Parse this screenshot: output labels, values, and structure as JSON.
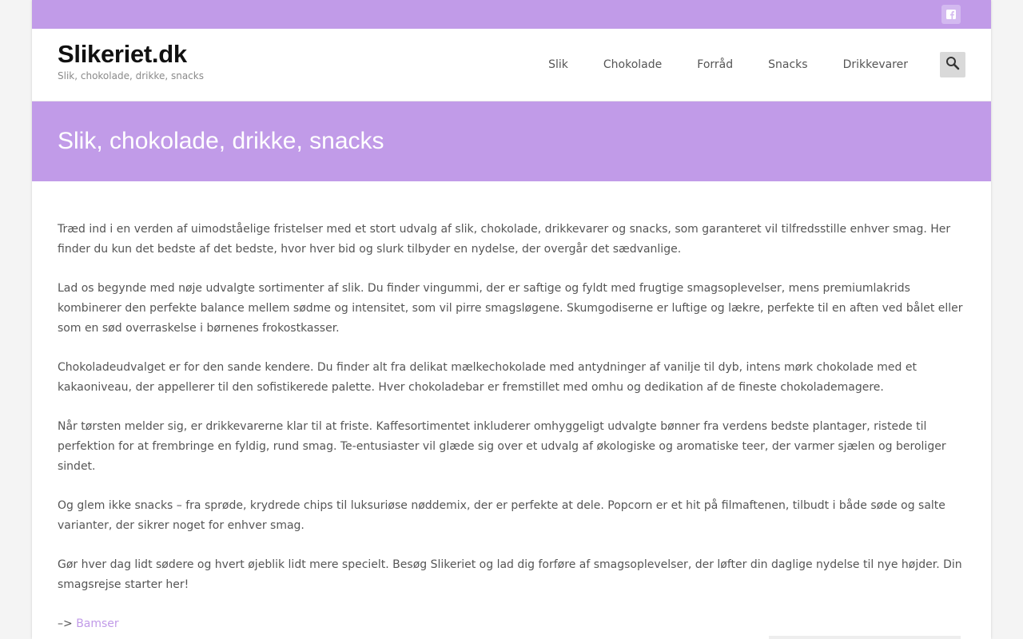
{
  "topbar": {
    "social_icon": "facebook-icon"
  },
  "header": {
    "site_title": "Slikeriet.dk",
    "tagline": "Slik, chokolade, drikke, snacks",
    "search_icon": "search-icon"
  },
  "nav": {
    "items": [
      "Slik",
      "Chokolade",
      "Forråd",
      "Snacks",
      "Drikkevarer"
    ]
  },
  "hero": {
    "title": "Slik, chokolade, drikke, snacks"
  },
  "content": {
    "paragraphs": [
      "Træd ind i en verden af uimodståelige fristelser med et stort udvalg af slik, chokolade, drikkevarer og snacks, som garanteret vil tilfredsstille enhver smag. Her finder du kun det bedste af det bedste, hvor hver bid og slurk tilbyder en nydelse, der overgår det sædvanlige.",
      "Lad os begynde med nøje udvalgte sortimenter af slik. Du finder vingummi, der er saftige og fyldt med frugtige smagsoplevelser, mens premiumlakrids kombinerer den perfekte balance mellem sødme og intensitet, som vil pirre smagsløgene. Skumgodiserne er luftige og lækre, perfekte til en aften ved bålet eller som en sød overraskelse i børnenes frokostkasser.",
      "Chokoladeudvalget er for den sande kendere. Du finder alt fra delikat mælkechokolade med antydninger af vanilje til dyb, intens mørk chokolade med et kakaoniveau, der appellerer til den sofistikerede palette. Hver chokoladebar er fremstillet med omhu og dedikation af de fineste chokolademagere.",
      "Når tørsten melder sig, er drikkevarerne klar til at friste. Kaffesortimentet inkluderer omhyggeligt udvalgte bønner fra verdens bedste plantager, ristede til perfektion for at frembringe en fyldig, rund smag. Te-entusiaster vil glæde sig over et udvalg af økologiske og aromatiske teer, der varmer sjælen og beroliger sindet.",
      "Og glem ikke snacks – fra sprøde, krydrede chips til luksuriøse nøddemix, der er perfekte at dele. Popcorn er et hit på filmaftenen, tilbudt i både søde og salte varianter, der sikrer noget for enhver smag.",
      "Gør hver dag lidt sødere og hvert øjeblik lidt mere specielt. Besøg Slikeriet og lad dig forføre af smagsoplevelser, der løfter din daglige nydelse til nye højder. Din smagsrejse starter her!"
    ],
    "link_prefix": "–>",
    "link_label": "Bamser"
  },
  "colors": {
    "accent": "#c19be8",
    "page_bg": "#f4f4f4",
    "text": "#555555"
  }
}
